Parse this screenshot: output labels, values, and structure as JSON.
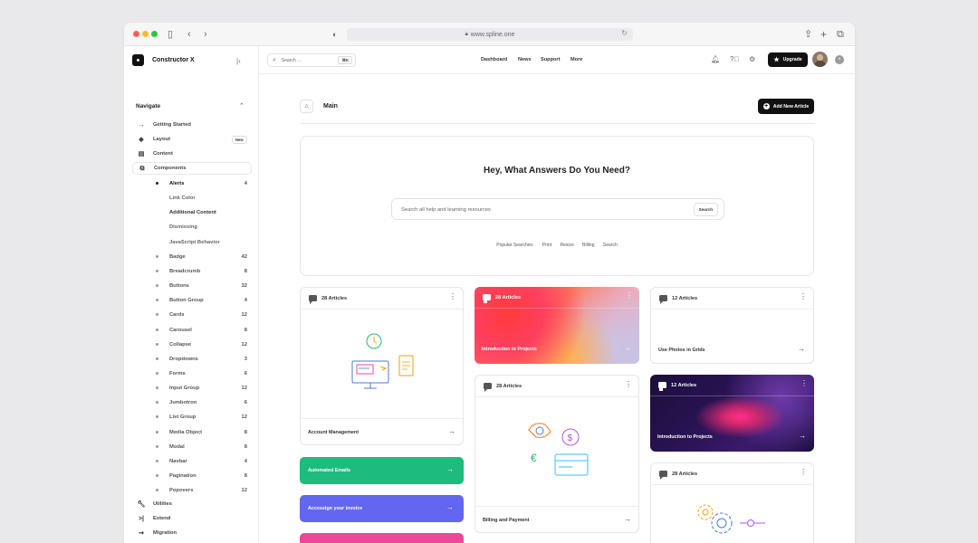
{
  "browser": {
    "url": "www.spline.one"
  },
  "sidebar": {
    "brand": "Constructor X",
    "section": "Navigate",
    "items": [
      {
        "label": "Getting Started"
      },
      {
        "label": "Layout",
        "badge": "New"
      },
      {
        "label": "Content"
      },
      {
        "label": "Components"
      }
    ],
    "components": [
      {
        "label": "Alerts",
        "count": "4"
      },
      {
        "label": "Link Color"
      },
      {
        "label": "Additional Content"
      },
      {
        "label": "Dismissing"
      },
      {
        "label": "JavaScript Behavior"
      },
      {
        "label": "Badge",
        "count": "42"
      },
      {
        "label": "Breadcrumb",
        "count": "8"
      },
      {
        "label": "Buttons",
        "count": "32"
      },
      {
        "label": "Button Group",
        "count": "4"
      },
      {
        "label": "Cards",
        "count": "12"
      },
      {
        "label": "Carousel",
        "count": "8"
      },
      {
        "label": "Collapse",
        "count": "12"
      },
      {
        "label": "Dropdowns",
        "count": "3"
      },
      {
        "label": "Forms",
        "count": "6"
      },
      {
        "label": "Input Group",
        "count": "12"
      },
      {
        "label": "Jumbotron",
        "count": "6"
      },
      {
        "label": "List Group",
        "count": "12"
      },
      {
        "label": "Media Object",
        "count": "8"
      },
      {
        "label": "Modal",
        "count": "8"
      },
      {
        "label": "Navbar",
        "count": "4"
      },
      {
        "label": "Pagination",
        "count": "8"
      },
      {
        "label": "Popovers",
        "count": "12"
      }
    ],
    "bottom": [
      {
        "label": "Utilities"
      },
      {
        "label": "Extend"
      },
      {
        "label": "Migration"
      }
    ]
  },
  "topbar": {
    "search_placeholder": "Search ...",
    "search_shortcut": "⌘K",
    "nav": [
      "Dashboard",
      "News",
      "Support",
      "More"
    ],
    "upgrade": "Upgrade"
  },
  "main": {
    "title": "Main",
    "add_button": "Add New Article",
    "hero": {
      "heading": "Hey, What Answers Do You Need?",
      "search_placeholder": "Search all help and learning resources",
      "search_button": "Search",
      "popular_label": "Popular Searches:",
      "popular": [
        "Print",
        "Resize",
        "Billing",
        "Search"
      ]
    },
    "cards": {
      "account": {
        "count": "28 Articles",
        "title": "Account Management"
      },
      "intro1": {
        "count": "28 Articles",
        "title": "Introduction to Projects"
      },
      "photos": {
        "count": "12 Articles",
        "title": "Use Photos in Grids"
      },
      "billing": {
        "count": "28 Articles",
        "title": "Billing and Payment"
      },
      "intro2": {
        "count": "12 Articles",
        "title": "Introduction to Projects"
      },
      "settings": {
        "count": "28 Articles"
      }
    },
    "pills": [
      {
        "label": "Automated Emails",
        "color": "#1dbb7e"
      },
      {
        "label": "Accessign your invoice",
        "color": "#6366f1"
      },
      {
        "color": "#ec4899"
      }
    ]
  },
  "colors": {
    "accent": "#111111",
    "green": "#1dbb7e",
    "purple": "#6366f1",
    "pink": "#ec4899"
  }
}
